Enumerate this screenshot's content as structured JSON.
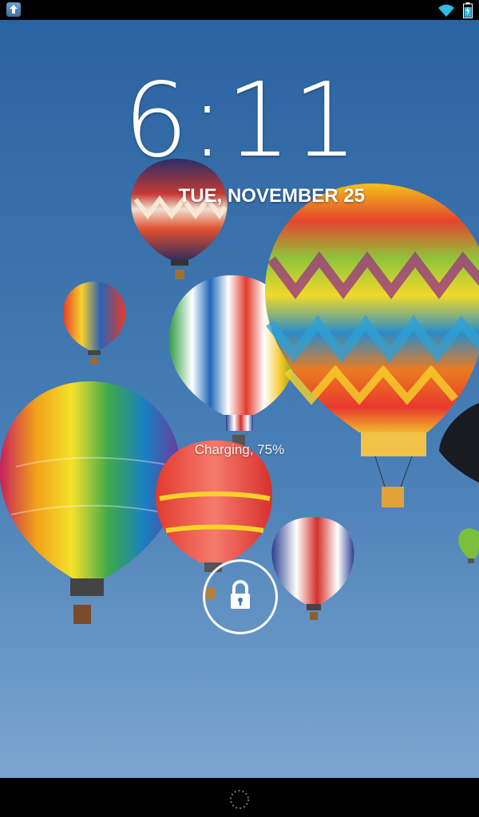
{
  "status_bar": {
    "left_icon": "upload-icon",
    "right_icons": [
      "wifi-icon",
      "battery-charging-icon"
    ]
  },
  "lock_screen": {
    "time": "6:11",
    "date": "TUE, NOVEMBER 25",
    "charging_status": "Charging, 75%",
    "battery_percent": 75,
    "unlock_icon": "lock-icon",
    "wallpaper": "hot-air-balloons"
  },
  "nav_bar": {
    "home_icon": "home-indicator-icon"
  },
  "colors": {
    "sky_top": "#2d66a3",
    "sky_bottom": "#6897c4",
    "text": "#ffffff",
    "wifi": "#30b8e6"
  }
}
